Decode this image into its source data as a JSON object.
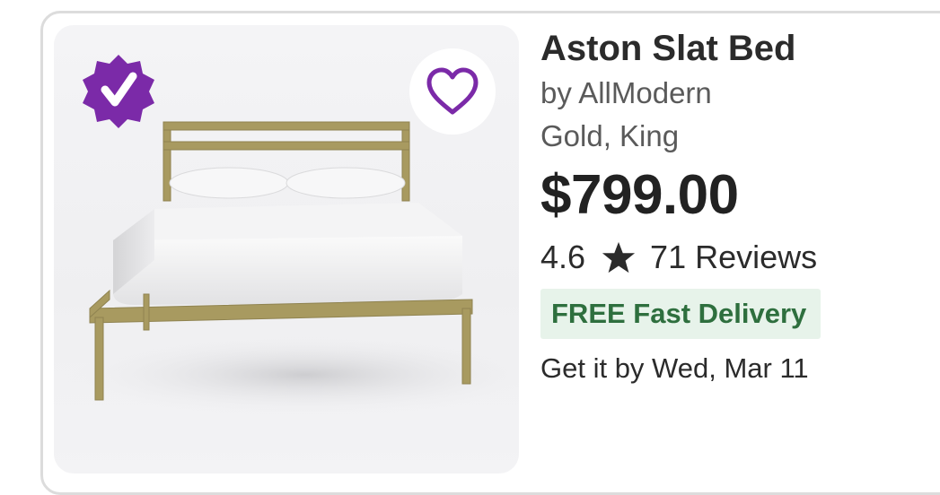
{
  "product": {
    "title": "Aston Slat Bed",
    "brand": "by AllModern",
    "variant": "Gold, King",
    "price": "$799.00",
    "rating": "4.6",
    "reviews": "71 Reviews",
    "delivery_badge": "FREE Fast Delivery",
    "eta": "Get it by Wed, Mar 11"
  },
  "icons": {
    "verified": "verified-badge-icon",
    "favorite": "heart-icon",
    "rating_star": "star-icon"
  },
  "colors": {
    "badge_purple": "#7b2aa8",
    "heart_purple": "#7b2aa8",
    "delivery_bg": "#e7f3ea",
    "delivery_text": "#2e6f3e",
    "bed_frame": "#a89a60"
  }
}
